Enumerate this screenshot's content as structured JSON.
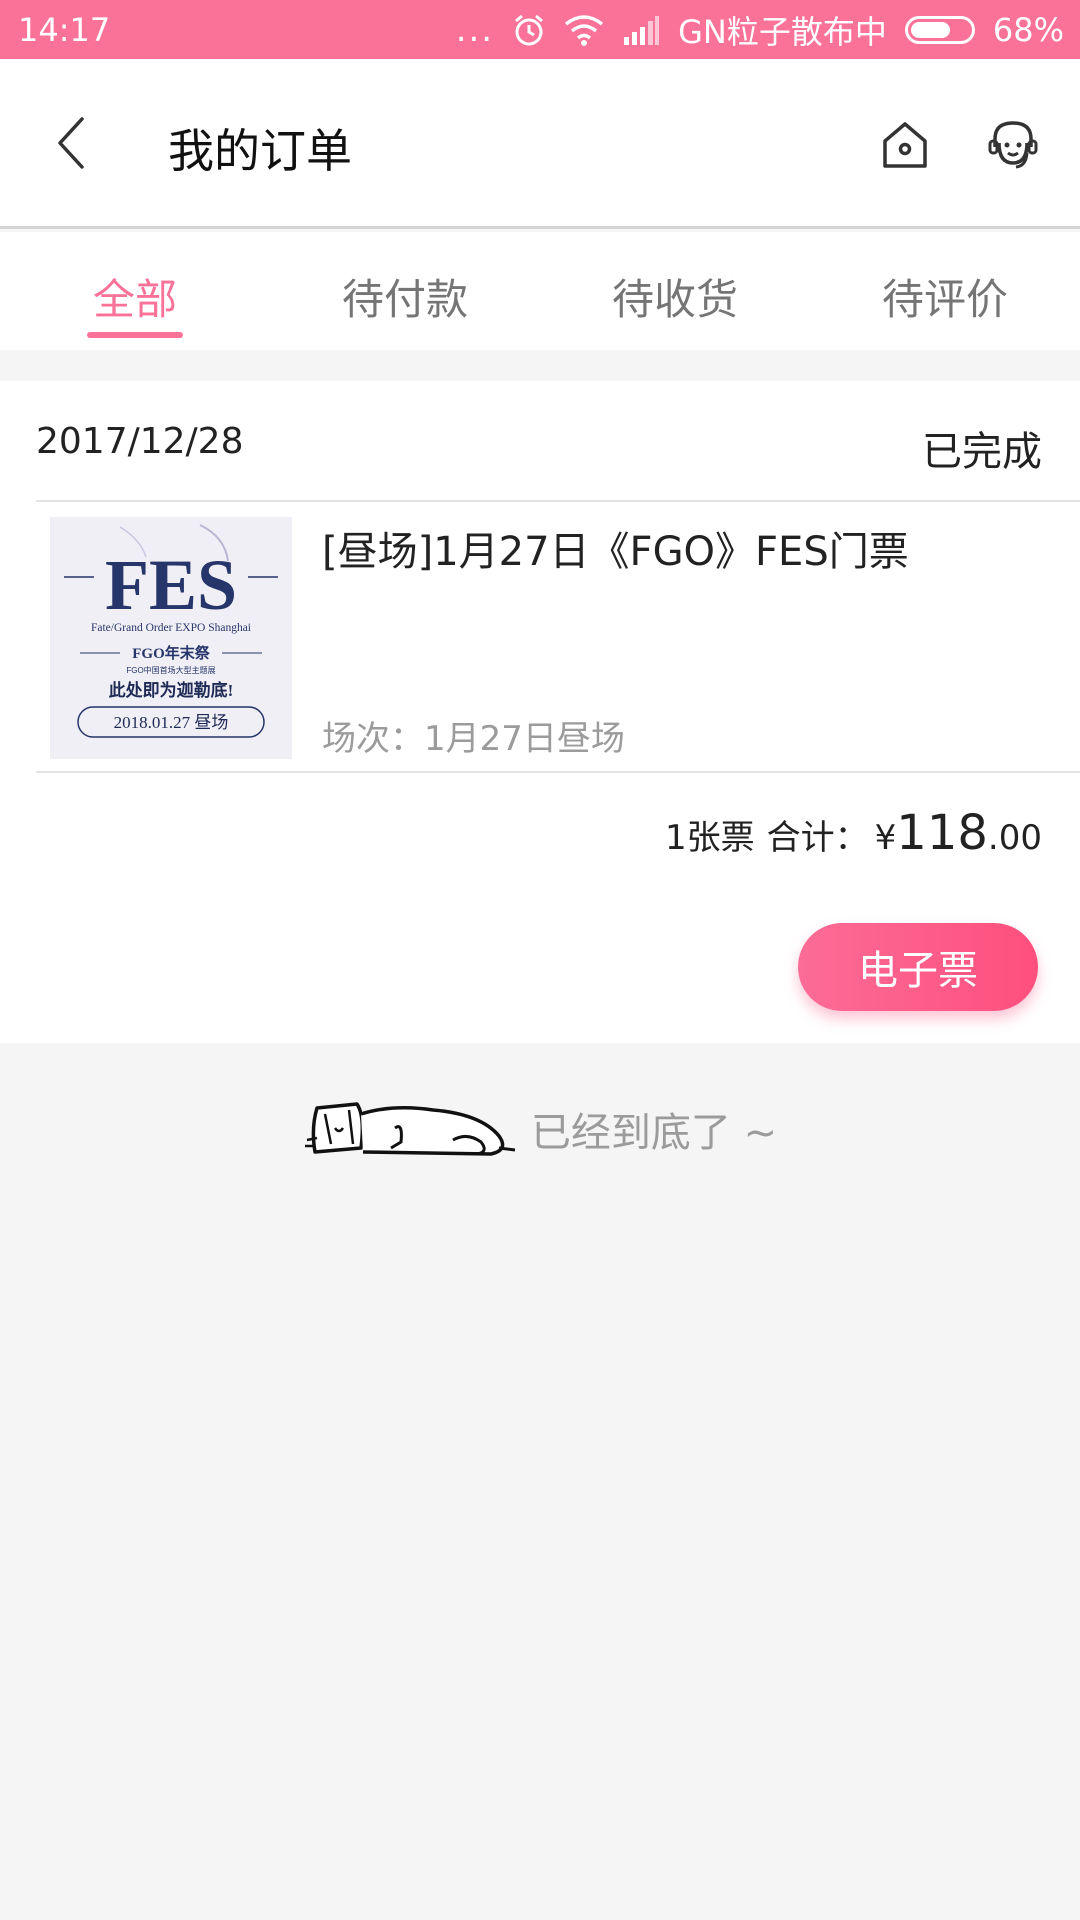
{
  "status_bar": {
    "time": "14:17",
    "dots": "...",
    "carrier": "GN粒子散布中",
    "battery_text": "68%",
    "battery_level": 0.68,
    "icons": [
      "alarm-icon",
      "wifi-icon",
      "signal-icon",
      "battery-icon"
    ]
  },
  "header": {
    "title": "我的订单",
    "icons": [
      "back-icon",
      "home-icon",
      "customer-service-icon"
    ]
  },
  "tabs": [
    {
      "label": "全部",
      "active": true
    },
    {
      "label": "待付款",
      "active": false
    },
    {
      "label": "待收货",
      "active": false
    },
    {
      "label": "待评价",
      "active": false
    }
  ],
  "order": {
    "date": "2017/12/28",
    "status": "已完成",
    "item": {
      "title": "[昼场]1月27日《FGO》FES门票",
      "session": "场次：1月27日昼场",
      "poster": {
        "headline": "FES",
        "subtitle": "Fate/Grand Order EXPO Shanghai",
        "event": "FGO年末祭",
        "event_sub": "FGO中国首场大型主题展",
        "slogan": "此处即为迦勒底!",
        "date_label": "2018.01.27  昼场"
      }
    },
    "summary": {
      "quantity": "1张票",
      "total_label": "合计：",
      "currency": "¥",
      "amount_int": "118",
      "amount_dec": ".00"
    },
    "eticket_button": "电子票"
  },
  "end_note": "已经到底了 ~",
  "colors": {
    "accent": "#fb7299",
    "button_gradient_start": "#fb6c96",
    "button_gradient_end": "#ff4f7e",
    "muted_text": "#9b9b9b",
    "page_bg": "#f5f5f5"
  }
}
